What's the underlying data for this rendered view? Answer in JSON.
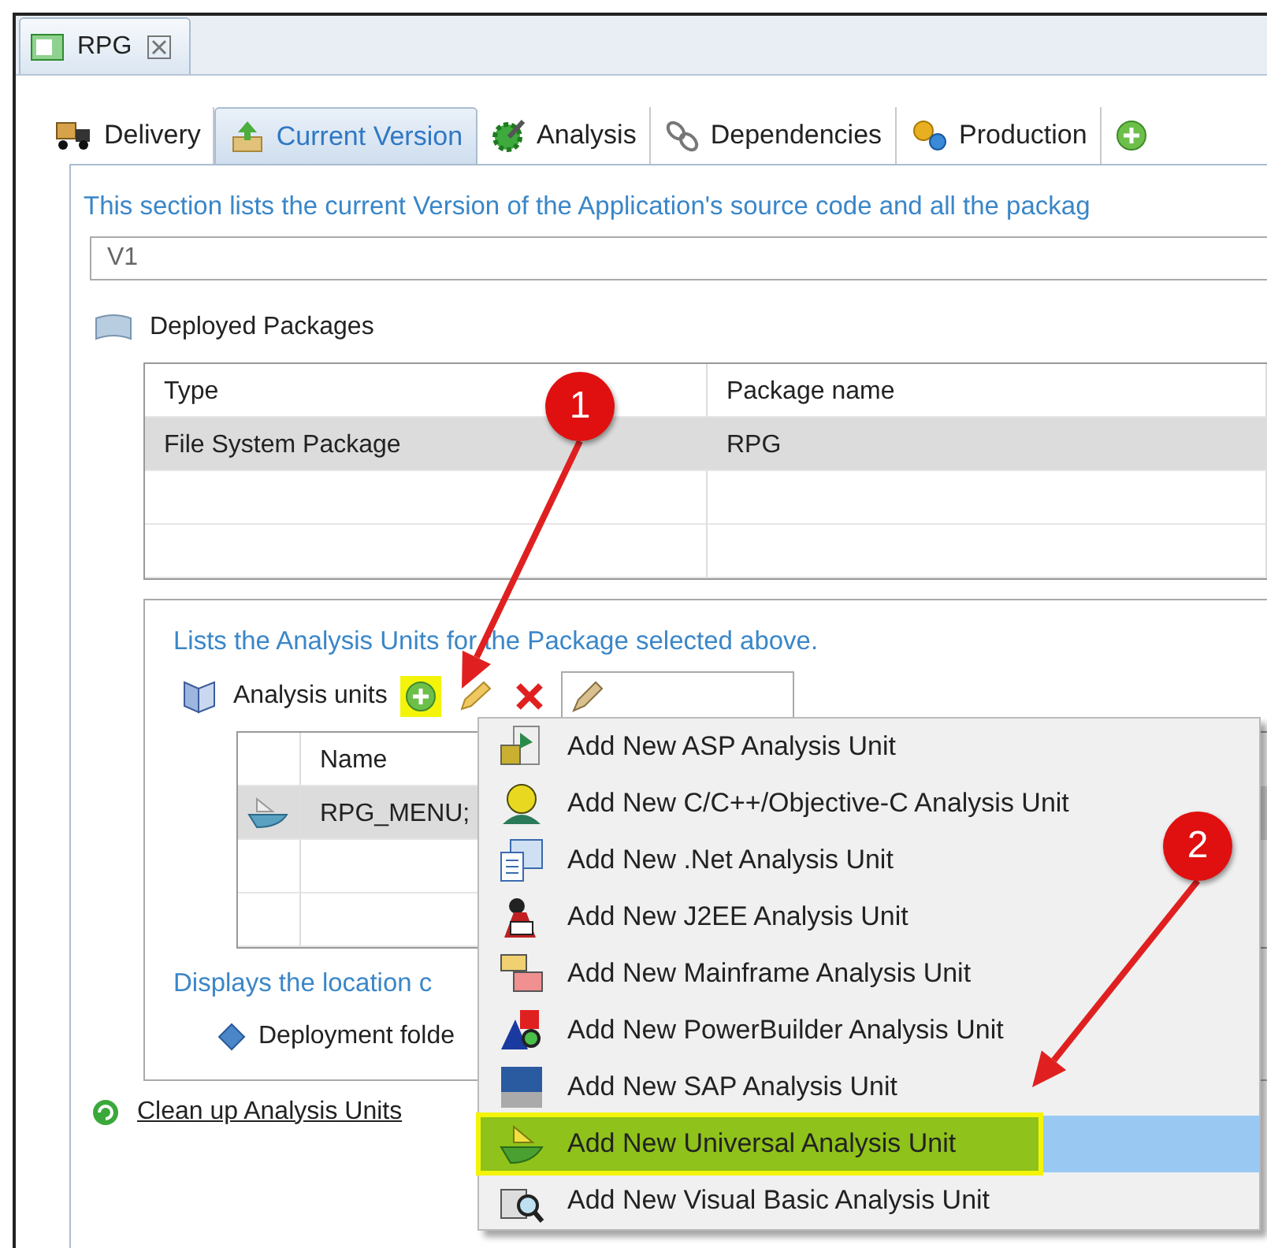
{
  "editor_tab": {
    "title": "RPG"
  },
  "tabs": [
    {
      "label": "Delivery",
      "selected": false
    },
    {
      "label": "Current Version",
      "selected": true
    },
    {
      "label": "Analysis",
      "selected": false
    },
    {
      "label": "Dependencies",
      "selected": false
    },
    {
      "label": "Production",
      "selected": false
    }
  ],
  "description": "This section lists the current Version of the Application's source code and all the packag",
  "version_field": {
    "value": "V1"
  },
  "deployed_packages": {
    "title": "Deployed Packages",
    "columns": [
      "Type",
      "Package name"
    ],
    "rows": [
      {
        "cells": [
          "File System Package",
          "RPG"
        ],
        "selected": true
      }
    ]
  },
  "analysis_units": {
    "description": "Lists the Analysis Units for the Package selected above.",
    "label": "Analysis units",
    "add_highlighted": true,
    "columns": [
      "Name"
    ],
    "rows": [
      {
        "cells": [
          "RPG_MENU;"
        ],
        "selected": true
      }
    ]
  },
  "location": {
    "description": "Displays the location c",
    "folder_label": "Deployment folde"
  },
  "cleanup_link": "Clean up Analysis Units",
  "context_menu": [
    {
      "label": "Add New ASP Analysis Unit",
      "selected": false,
      "highlighted": false
    },
    {
      "label": "Add New C/C++/Objective-C Analysis Unit",
      "selected": false,
      "highlighted": false
    },
    {
      "label": "Add New .Net Analysis Unit",
      "selected": false,
      "highlighted": false
    },
    {
      "label": "Add New J2EE Analysis Unit",
      "selected": false,
      "highlighted": false
    },
    {
      "label": "Add New Mainframe Analysis Unit",
      "selected": false,
      "highlighted": false
    },
    {
      "label": "Add New PowerBuilder Analysis Unit",
      "selected": false,
      "highlighted": false
    },
    {
      "label": "Add New SAP Analysis Unit",
      "selected": false,
      "highlighted": false
    },
    {
      "label": "Add New Universal Analysis Unit",
      "selected": true,
      "highlighted": true
    },
    {
      "label": "Add New Visual Basic Analysis Unit",
      "selected": false,
      "highlighted": false
    }
  ],
  "callouts": [
    {
      "label": "1"
    },
    {
      "label": "2"
    }
  ]
}
